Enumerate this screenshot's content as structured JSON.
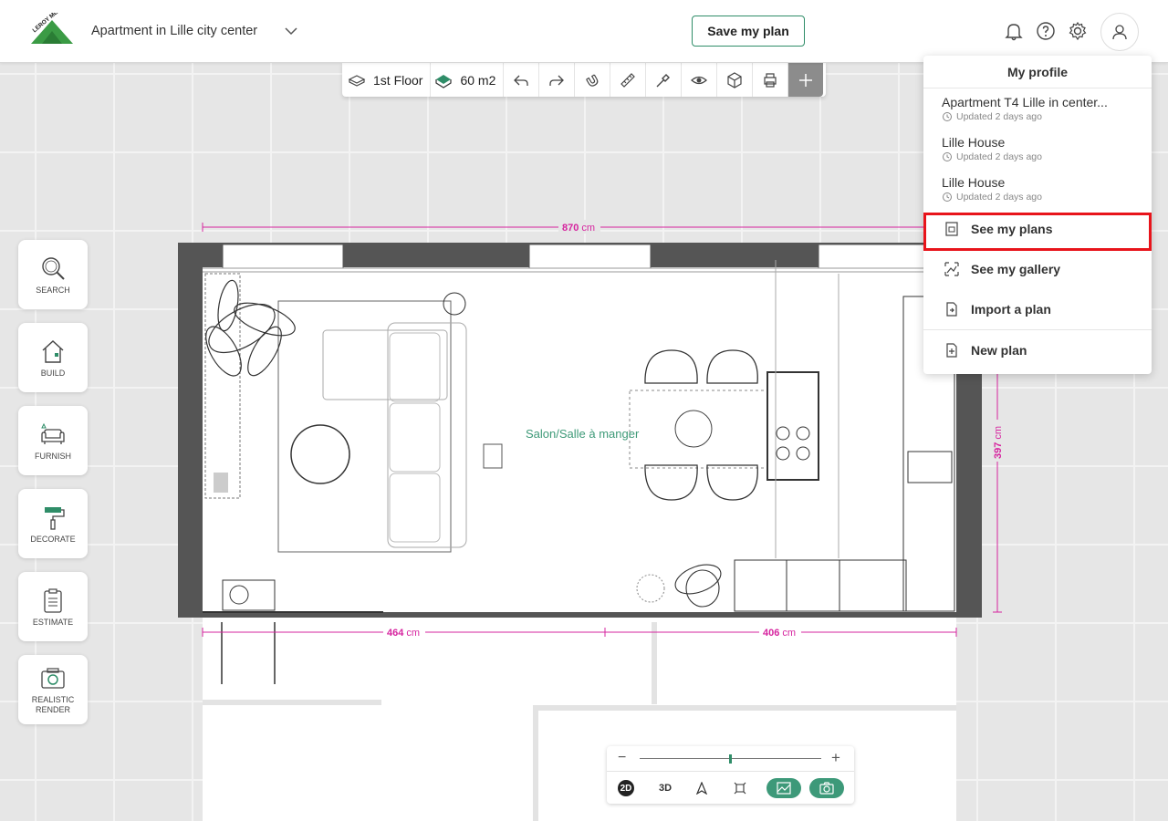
{
  "header": {
    "logo_text": "LEROY MERLIN",
    "project_title": "Apartment in Lille city center",
    "save_label": "Save my plan"
  },
  "toolbar": {
    "floor_label": "1st Floor",
    "area_label": "60 m2",
    "icons": [
      "floor-icon",
      "area-icon",
      "undo-icon",
      "redo-icon",
      "magnet-icon",
      "ruler-icon",
      "eyedropper-icon",
      "eye-icon",
      "cube-icon",
      "print-icon",
      "add-icon"
    ]
  },
  "sidebar": {
    "items": [
      {
        "label": "SEARCH",
        "icon": "search-icon"
      },
      {
        "label": "BUILD",
        "icon": "house-icon"
      },
      {
        "label": "FURNISH",
        "icon": "sofa-icon"
      },
      {
        "label": "DECORATE",
        "icon": "paint-roller-icon"
      },
      {
        "label": "ESTIMATE",
        "icon": "clipboard-icon"
      },
      {
        "label": "REALISTIC RENDER",
        "icon": "camera-icon"
      }
    ]
  },
  "plan": {
    "room_label": "Salon/Salle à manger",
    "dim_top": "870",
    "dim_right": "397",
    "dim_bottom_left": "464",
    "dim_bottom_right": "406",
    "unit": "cm",
    "dim_color": "#d6249f"
  },
  "zoom": {
    "minus": "−",
    "plus": "+",
    "level": 0.5,
    "view_2d": "2D",
    "view_3d": "3D"
  },
  "profile_menu": {
    "title": "My profile",
    "recent": [
      {
        "name": "Apartment T4 Lille in center...",
        "updated": "Updated 2 days ago"
      },
      {
        "name": "Lille House",
        "updated": "Updated 2 days ago"
      },
      {
        "name": "Lille House",
        "updated": "Updated 2 days ago"
      }
    ],
    "actions": [
      {
        "label": "See my plans",
        "icon": "plans-icon"
      },
      {
        "label": "See my gallery",
        "icon": "gallery-icon"
      },
      {
        "label": "Import a plan",
        "icon": "import-icon"
      },
      {
        "label": "New plan",
        "icon": "new-plan-icon"
      }
    ]
  },
  "colors": {
    "brand_green": "#2f8d68",
    "highlight_red": "#e8141b",
    "wall_gray": "#555555"
  }
}
